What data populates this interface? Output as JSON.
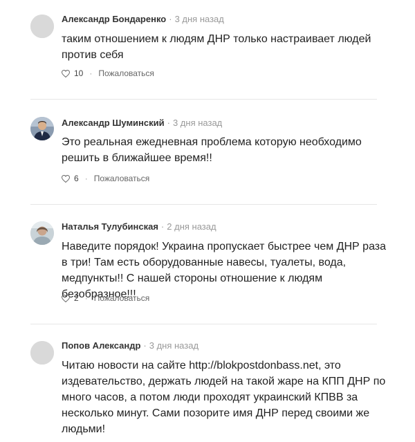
{
  "comments": [
    {
      "author": "Александр Бондаренко",
      "separator": "·",
      "time": "3 дня назад",
      "text": "таким отношением к людям ДНР только настраивает людей против себя",
      "likes": "10",
      "action_separator": "·",
      "report_label": "Пожаловаться",
      "avatar": "placeholder-avatar"
    },
    {
      "author": "Александр Шуминский",
      "separator": "·",
      "time": "3 дня назад",
      "text": "Это реальная ежедневная проблема которую необходимо решить в ближайшее время!!",
      "likes": "6",
      "action_separator": "·",
      "report_label": "Пожаловаться",
      "avatar": "photo-avatar"
    },
    {
      "author": "Наталья Тулубинская",
      "separator": "·",
      "time": "2 дня назад",
      "text": "Наведите порядок! Украина пропускает быстрее чем ДНР раза в три! Там есть оборудованные навесы, туалеты, вода, медпункты!! С нашей стороны отношение к людям безобразное!!!",
      "likes": "2",
      "action_separator": "·",
      "report_label": "Пожаловаться",
      "avatar": "photo-avatar"
    },
    {
      "author": "Попов Александр",
      "separator": "·",
      "time": "3 дня назад",
      "text": "Читаю новости на сайте http://blokpostdonbass.net, это издевательство, держать людей на такой жаре на КПП ДНР по много часов, а потом люди проходят украинский КПВВ за несколько минут. Сами позорите имя ДНР перед своими же людьми!",
      "avatar": "placeholder-avatar"
    }
  ],
  "colors": {
    "text": "#222222",
    "muted": "#999999",
    "divider": "#e6e6e6",
    "avatar_placeholder": "#d9d9d9"
  }
}
